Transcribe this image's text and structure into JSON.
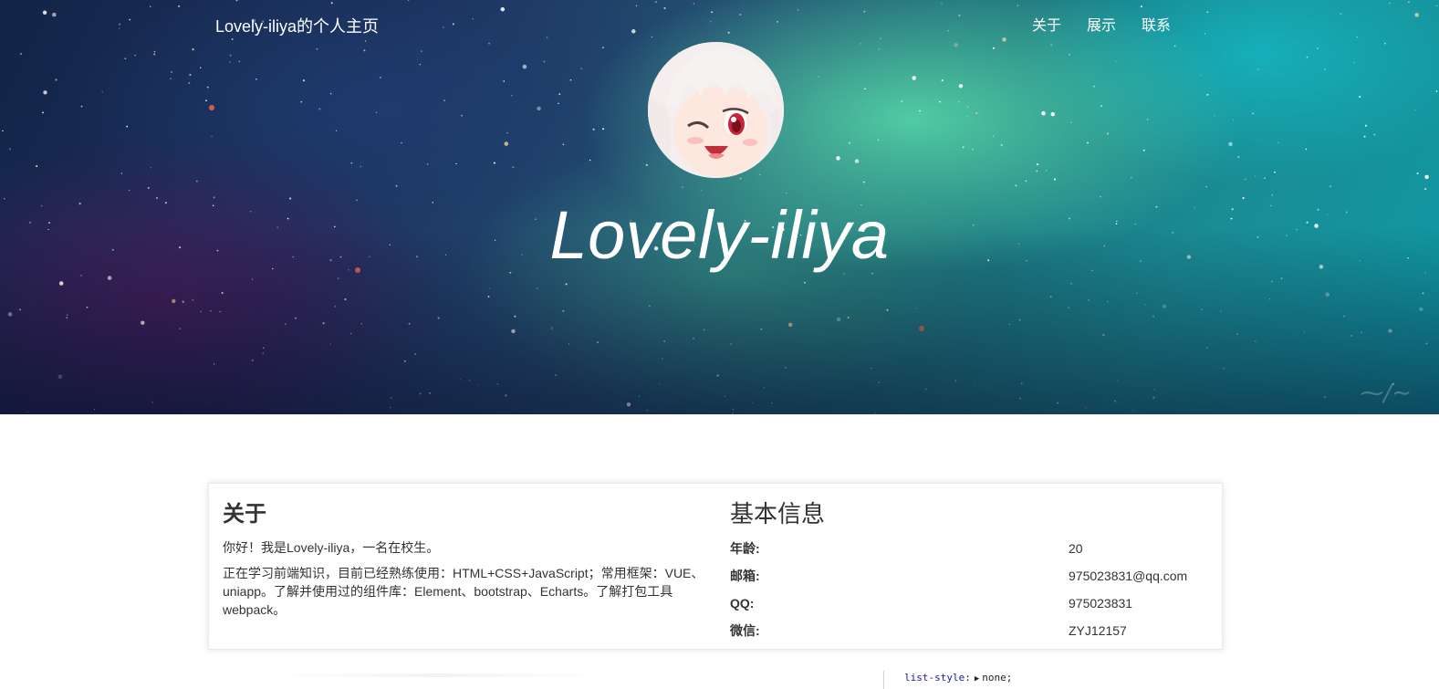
{
  "nav": {
    "brand": "Lovely-iliya的个人主页",
    "links": [
      "关于",
      "展示",
      "联系"
    ]
  },
  "hero": {
    "title": "Lovely-iliya",
    "avatar": "anime-avatar-icon"
  },
  "about": {
    "heading": "关于",
    "paragraphs": [
      "你好！我是Lovely-iliya，一名在校生。",
      "正在学习前端知识，目前已经熟练使用：HTML+CSS+JavaScript；常用框架：VUE、uniapp。了解并使用过的组件库：Element、bootstrap、Echarts。了解打包工具webpack。"
    ]
  },
  "info": {
    "heading": "基本信息",
    "rows": [
      {
        "label": "年龄:",
        "value": "20"
      },
      {
        "label": "邮箱:",
        "value": "975023831@qq.com"
      },
      {
        "label": "QQ:",
        "value": "975023831"
      },
      {
        "label": "微信:",
        "value": "ZYJ12157"
      }
    ]
  },
  "devtools": {
    "property": "list-style",
    "value": "none;"
  },
  "colors": {
    "text": "#333333",
    "hero_teal": "#1a8b93",
    "hero_navy": "#122447"
  }
}
